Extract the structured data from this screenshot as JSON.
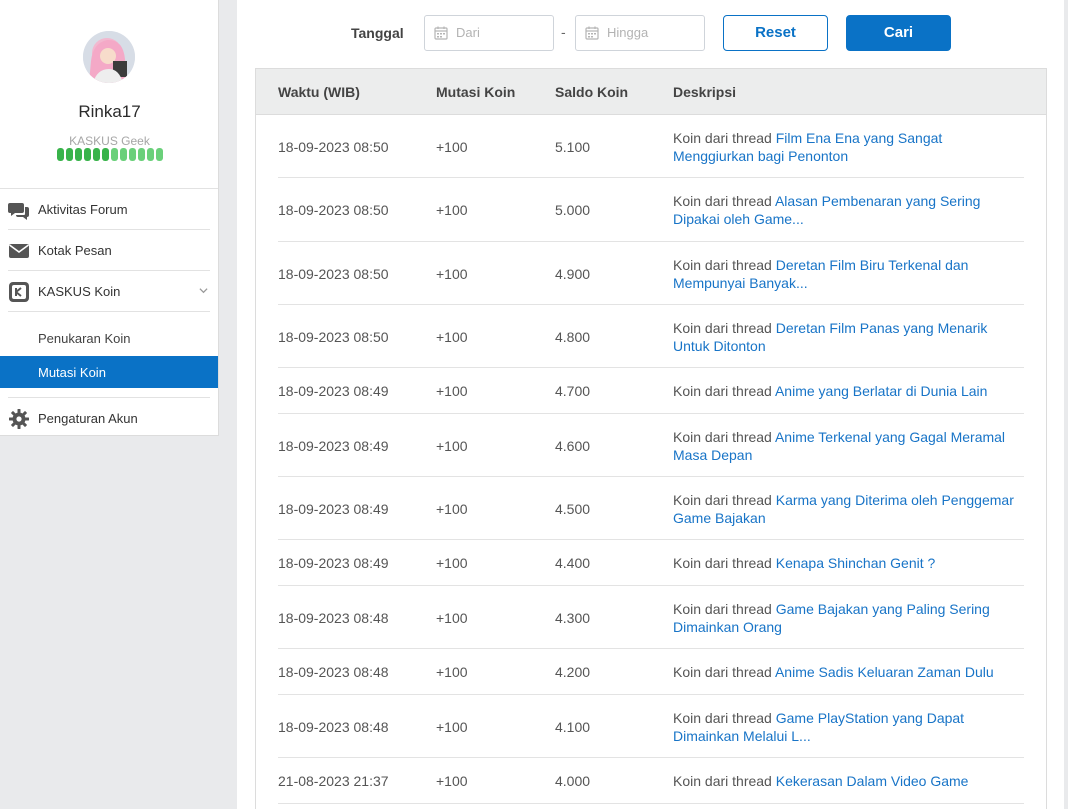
{
  "profile": {
    "username": "Rinka17",
    "rank": "KASKUS Geek",
    "level_colors": [
      "#38b34a",
      "#38b34a",
      "#38b34a",
      "#38b34a",
      "#38b34a",
      "#38b34a",
      "#6ad07a",
      "#6ad07a",
      "#6ad07a",
      "#6ad07a",
      "#6ad07a",
      "#6ad07a"
    ]
  },
  "menu": {
    "forum": "Aktivitas Forum",
    "inbox": "Kotak Pesan",
    "koin": "KASKUS Koin",
    "penukaran": "Penukaran Koin",
    "mutasi": "Mutasi Koin",
    "settings": "Pengaturan Akun"
  },
  "filter": {
    "label": "Tanggal",
    "from_placeholder": "Dari",
    "to_placeholder": "Hingga",
    "separator": "-",
    "reset": "Reset",
    "search": "Cari"
  },
  "table": {
    "headers": [
      "Waktu (WIB)",
      "Mutasi Koin",
      "Saldo Koin",
      "Deskripsi"
    ],
    "desc_prefix": "Koin dari thread",
    "rows": [
      {
        "time": "18-09-2023 08:50",
        "change": "+100",
        "balance": "5.100",
        "thread": "Film Ena Ena yang Sangat Menggiurkan bagi Penonton"
      },
      {
        "time": "18-09-2023 08:50",
        "change": "+100",
        "balance": "5.000",
        "thread": "Alasan Pembenaran yang Sering Dipakai oleh Game..."
      },
      {
        "time": "18-09-2023 08:50",
        "change": "+100",
        "balance": "4.900",
        "thread": "Deretan Film Biru Terkenal dan Mempunyai Banyak..."
      },
      {
        "time": "18-09-2023 08:50",
        "change": "+100",
        "balance": "4.800",
        "thread": "Deretan Film Panas yang Menarik Untuk Ditonton"
      },
      {
        "time": "18-09-2023 08:49",
        "change": "+100",
        "balance": "4.700",
        "thread": "Anime yang Berlatar di Dunia Lain"
      },
      {
        "time": "18-09-2023 08:49",
        "change": "+100",
        "balance": "4.600",
        "thread": "Anime Terkenal yang Gagal Meramal Masa Depan"
      },
      {
        "time": "18-09-2023 08:49",
        "change": "+100",
        "balance": "4.500",
        "thread": "Karma yang Diterima oleh Penggemar Game Bajakan"
      },
      {
        "time": "18-09-2023 08:49",
        "change": "+100",
        "balance": "4.400",
        "thread": "Kenapa Shinchan Genit ?"
      },
      {
        "time": "18-09-2023 08:48",
        "change": "+100",
        "balance": "4.300",
        "thread": "Game Bajakan yang Paling Sering Dimainkan Orang"
      },
      {
        "time": "18-09-2023 08:48",
        "change": "+100",
        "balance": "4.200",
        "thread": "Anime Sadis Keluaran Zaman Dulu"
      },
      {
        "time": "18-09-2023 08:48",
        "change": "+100",
        "balance": "4.100",
        "thread": "Game PlayStation yang Dapat Dimainkan Melalui L..."
      },
      {
        "time": "21-08-2023 21:37",
        "change": "+100",
        "balance": "4.000",
        "thread": "Kekerasan Dalam Video Game"
      }
    ]
  }
}
